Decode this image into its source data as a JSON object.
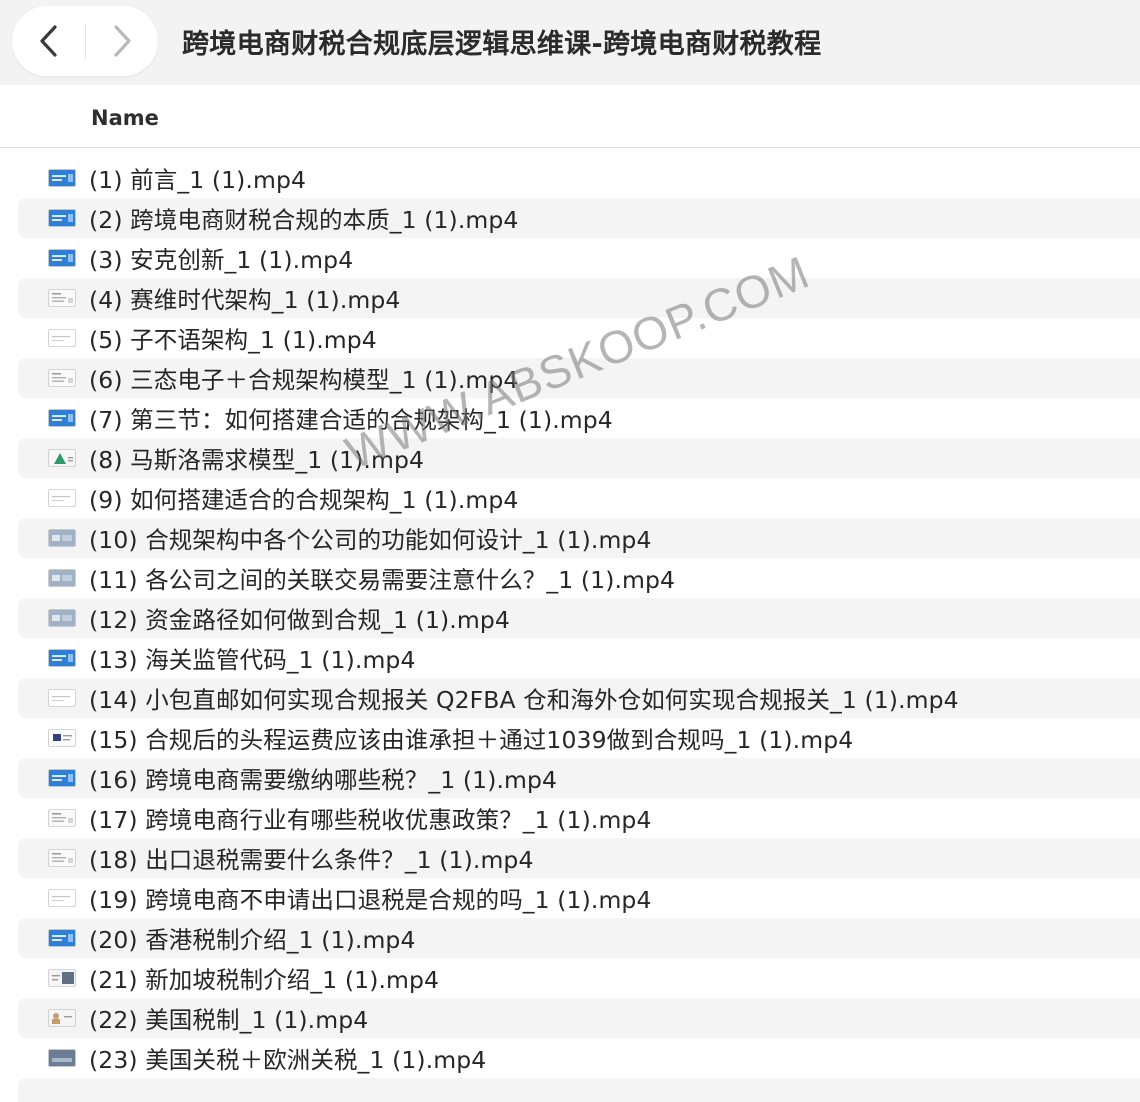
{
  "window": {
    "title": "跨境电商财税合规底层逻辑思维课-跨境电商财税教程"
  },
  "toolbar": {
    "back_icon": "chevron-left-icon",
    "forward_icon": "chevron-right-icon"
  },
  "columns": {
    "name": "Name"
  },
  "watermark": "WWW.ABSKOOP.COM",
  "files": [
    {
      "name": "(1) 前言_1 (1).mp4",
      "thumb": "blue"
    },
    {
      "name": "(2) 跨境电商财税合规的本质_1 (1).mp4",
      "thumb": "blue"
    },
    {
      "name": "(3) 安克创新_1 (1).mp4",
      "thumb": "blue"
    },
    {
      "name": "(4) 赛维时代架构_1 (1).mp4",
      "thumb": "doc"
    },
    {
      "name": "(5) 子不语架构_1 (1).mp4",
      "thumb": "light"
    },
    {
      "name": "(6) 三态电子＋合规架构模型_1 (1).mp4",
      "thumb": "doc"
    },
    {
      "name": "(7) 第三节：如何搭建合适的合规架构_1 (1).mp4",
      "thumb": "blue"
    },
    {
      "name": "(8) 马斯洛需求模型_1 (1).mp4",
      "thumb": "pyramid"
    },
    {
      "name": "(9) 如何搭建适合的合规架构_1 (1).mp4",
      "thumb": "light"
    },
    {
      "name": "(10) 合规架构中各个公司的功能如何设计_1 (1).mp4",
      "thumb": "grey"
    },
    {
      "name": "(11) 各公司之间的关联交易需要注意什么？_1 (1).mp4",
      "thumb": "grey"
    },
    {
      "name": "(12) 资金路径如何做到合规_1 (1).mp4",
      "thumb": "grey"
    },
    {
      "name": "(13) 海关监管代码_1 (1).mp4",
      "thumb": "blue"
    },
    {
      "name": "(14) 小包直邮如何实现合规报关 Q2FBA 仓和海外仓如何实现合规报关_1 (1).mp4",
      "thumb": "light"
    },
    {
      "name": "(15) 合规后的头程运费应该由谁承担＋通过1039做到合规吗_1 (1).mp4",
      "thumb": "dark"
    },
    {
      "name": "(16) 跨境电商需要缴纳哪些税？_1 (1).mp4",
      "thumb": "blue"
    },
    {
      "name": "(17) 跨境电商行业有哪些税收优惠政策？_1 (1).mp4",
      "thumb": "doc"
    },
    {
      "name": "(18) 出口退税需要什么条件？_1 (1).mp4",
      "thumb": "doc"
    },
    {
      "name": "(19) 跨境电商不申请出口退税是合规的吗_1 (1).mp4",
      "thumb": "light"
    },
    {
      "name": "(20) 香港税制介绍_1 (1).mp4",
      "thumb": "blue"
    },
    {
      "name": "(21) 新加坡税制介绍_1 (1).mp4",
      "thumb": "photo"
    },
    {
      "name": "(22) 美国税制_1 (1).mp4",
      "thumb": "people"
    },
    {
      "name": "(23) 美国关税＋欧洲关税_1 (1).mp4",
      "thumb": "photo2"
    }
  ]
}
